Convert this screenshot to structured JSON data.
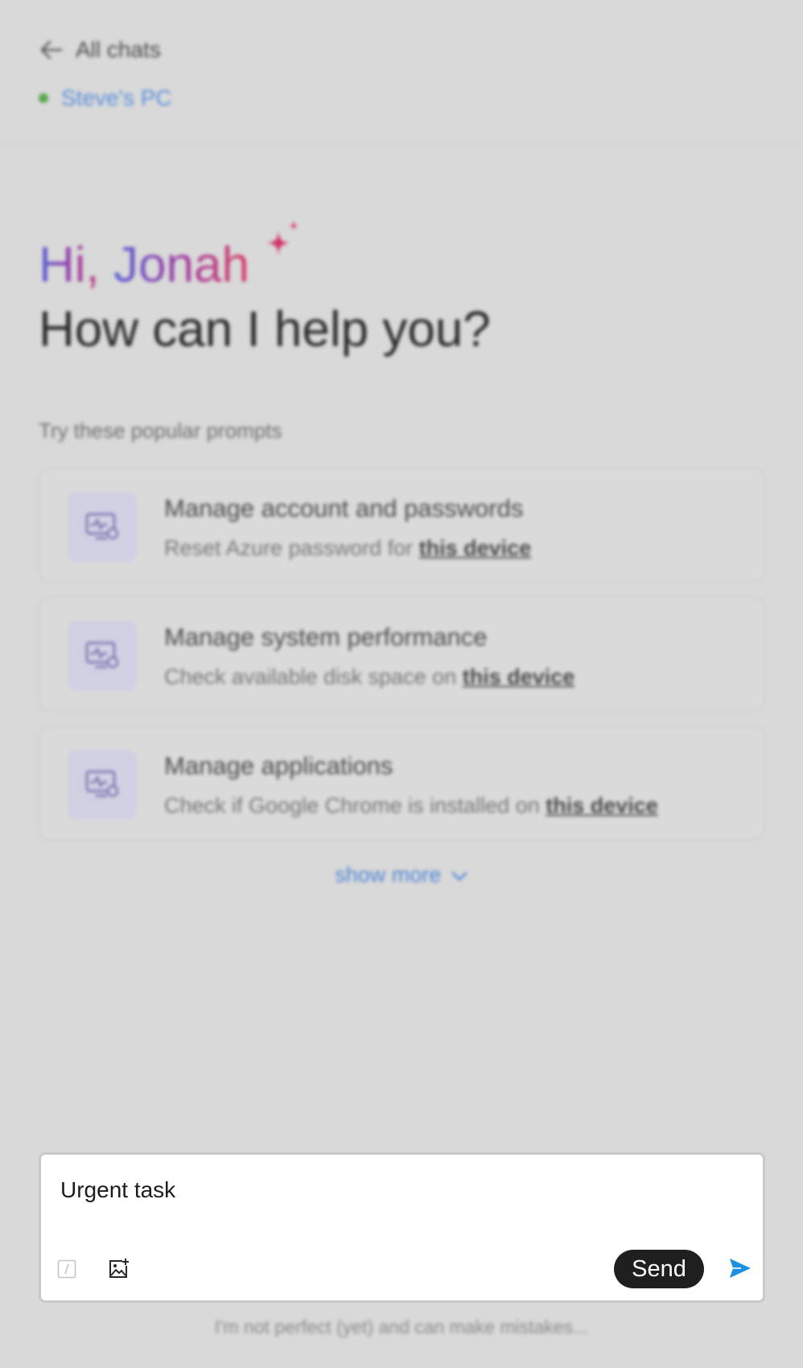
{
  "header": {
    "back_label": "All chats",
    "device_name": "Steve's PC",
    "device_status": "online"
  },
  "hero": {
    "greeting_prefix": "Hi, ",
    "user_name": "Jonah",
    "question": "How can I help you?"
  },
  "prompts": {
    "label": "Try these popular prompts",
    "items": [
      {
        "title": "Manage account and passwords",
        "subtitle_prefix": "Reset Azure password for ",
        "subtitle_link": "this device",
        "icon": "monitor-performance-icon"
      },
      {
        "title": "Manage system performance",
        "subtitle_prefix": "Check available disk space on ",
        "subtitle_link": "this device",
        "icon": "monitor-performance-icon"
      },
      {
        "title": "Manage applications",
        "subtitle_prefix": "Check if Google Chrome is installed on ",
        "subtitle_link": "this device",
        "icon": "monitor-performance-icon"
      }
    ],
    "show_more_label": "show more"
  },
  "composer": {
    "input_value": "Urgent task",
    "send_label": "Send"
  },
  "footer": {
    "disclaimer": "I'm not perfect (yet) and can make mistakes..."
  },
  "colors": {
    "background": "#d9d9d9",
    "accent_blue": "#1f8fe0",
    "status_green": "#58a84a",
    "gradient_start": "#5b63d6",
    "gradient_end": "#d93d6a"
  }
}
